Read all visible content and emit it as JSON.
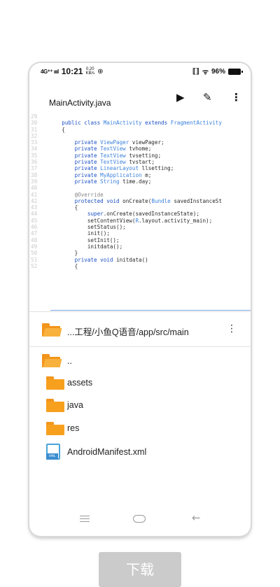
{
  "status_bar": {
    "signal": "4G⁺⁺ ıııl",
    "time": "10:21",
    "net_speed_value": "0.20",
    "net_speed_unit": "KB/s",
    "small_icon": "⊕",
    "vibrate": "⟦⟧",
    "wifi": "ᯤ",
    "battery_percent": "96%"
  },
  "toolbar": {
    "file_name": "MainActivity.java",
    "run_icon": "▶",
    "edit_icon": "✎",
    "more_icon": "⋮"
  },
  "code": {
    "lines": [
      {
        "n": "29",
        "parts": [
          {
            "t": "",
            "c": ""
          }
        ]
      },
      {
        "n": "30",
        "parts": [
          {
            "t": "    ",
            "c": ""
          },
          {
            "t": "public class ",
            "c": "kw"
          },
          {
            "t": "MainActivity ",
            "c": "ty"
          },
          {
            "t": "extends ",
            "c": "kw"
          },
          {
            "t": "FragmentActivity",
            "c": "ty"
          }
        ]
      },
      {
        "n": "31",
        "parts": [
          {
            "t": "    {",
            "c": ""
          }
        ]
      },
      {
        "n": "32",
        "parts": [
          {
            "t": "",
            "c": ""
          }
        ]
      },
      {
        "n": "33",
        "parts": [
          {
            "t": "        ",
            "c": ""
          },
          {
            "t": "private ",
            "c": "kw"
          },
          {
            "t": "ViewPager ",
            "c": "ty"
          },
          {
            "t": "viewPager;",
            "c": ""
          }
        ]
      },
      {
        "n": "34",
        "parts": [
          {
            "t": "        ",
            "c": ""
          },
          {
            "t": "private ",
            "c": "kw"
          },
          {
            "t": "TextView ",
            "c": "ty"
          },
          {
            "t": "tvhome;",
            "c": ""
          }
        ]
      },
      {
        "n": "35",
        "parts": [
          {
            "t": "        ",
            "c": ""
          },
          {
            "t": "private ",
            "c": "kw"
          },
          {
            "t": "TextView ",
            "c": "ty"
          },
          {
            "t": "tvsetting;",
            "c": ""
          }
        ]
      },
      {
        "n": "36",
        "parts": [
          {
            "t": "        ",
            "c": ""
          },
          {
            "t": "private ",
            "c": "kw"
          },
          {
            "t": "TextView ",
            "c": "ty"
          },
          {
            "t": "tvstart;",
            "c": ""
          }
        ]
      },
      {
        "n": "37",
        "parts": [
          {
            "t": "        ",
            "c": ""
          },
          {
            "t": "private ",
            "c": "kw"
          },
          {
            "t": "LinearLayout ",
            "c": "ty"
          },
          {
            "t": "llsetting;",
            "c": ""
          }
        ]
      },
      {
        "n": "38",
        "parts": [
          {
            "t": "        ",
            "c": ""
          },
          {
            "t": "private ",
            "c": "kw"
          },
          {
            "t": "MyApplication ",
            "c": "ty"
          },
          {
            "t": "m;",
            "c": ""
          }
        ]
      },
      {
        "n": "39",
        "parts": [
          {
            "t": "        ",
            "c": ""
          },
          {
            "t": "private ",
            "c": "kw"
          },
          {
            "t": "String ",
            "c": "ty"
          },
          {
            "t": "time.day;",
            "c": ""
          }
        ]
      },
      {
        "n": "40",
        "parts": [
          {
            "t": "",
            "c": ""
          }
        ]
      },
      {
        "n": "41",
        "parts": [
          {
            "t": "        ",
            "c": ""
          },
          {
            "t": "@Override",
            "c": "an"
          }
        ]
      },
      {
        "n": "42",
        "parts": [
          {
            "t": "        ",
            "c": ""
          },
          {
            "t": "protected void ",
            "c": "kw"
          },
          {
            "t": "onCreate(",
            "c": ""
          },
          {
            "t": "Bundle ",
            "c": "ty"
          },
          {
            "t": "savedInstanceSt",
            "c": ""
          }
        ]
      },
      {
        "n": "43",
        "parts": [
          {
            "t": "        {",
            "c": ""
          }
        ]
      },
      {
        "n": "44",
        "parts": [
          {
            "t": "            ",
            "c": ""
          },
          {
            "t": "super",
            "c": "kw"
          },
          {
            "t": ".onCreate(savedInstanceState);",
            "c": ""
          }
        ]
      },
      {
        "n": "45",
        "parts": [
          {
            "t": "            setContentView(",
            "c": ""
          },
          {
            "t": "R",
            "c": "ty"
          },
          {
            "t": ".layout.activity_main);",
            "c": ""
          }
        ]
      },
      {
        "n": "46",
        "parts": [
          {
            "t": "            setStatus();",
            "c": ""
          }
        ]
      },
      {
        "n": "47",
        "parts": [
          {
            "t": "            init();",
            "c": ""
          }
        ]
      },
      {
        "n": "48",
        "parts": [
          {
            "t": "            setInit();",
            "c": ""
          }
        ]
      },
      {
        "n": "49",
        "parts": [
          {
            "t": "            initdata();",
            "c": ""
          }
        ]
      },
      {
        "n": "50",
        "parts": [
          {
            "t": "        }",
            "c": ""
          }
        ]
      },
      {
        "n": "51",
        "parts": [
          {
            "t": "        ",
            "c": ""
          },
          {
            "t": "private void ",
            "c": "kw"
          },
          {
            "t": "initdata()",
            "c": ""
          }
        ]
      },
      {
        "n": "52",
        "parts": [
          {
            "t": "        {",
            "c": ""
          }
        ]
      }
    ]
  },
  "path_bar": {
    "path": "...工程/小鱼Q语音/app/src/main",
    "more_icon": "⋮"
  },
  "file_list": [
    {
      "name": "..",
      "icon": "folder-open-icon"
    },
    {
      "name": "assets",
      "icon": "folder-icon"
    },
    {
      "name": "java",
      "icon": "folder-icon"
    },
    {
      "name": "res",
      "icon": "folder-icon"
    },
    {
      "name": "AndroidManifest.xml",
      "icon": "xml-file-icon",
      "badge": "XML"
    }
  ],
  "nav_bar": {
    "back_icon": "←"
  },
  "download_button": {
    "label": "下载"
  },
  "colors": {
    "folder": "#f7a01e",
    "keyword": "#1a4fc4",
    "type": "#3c82dc",
    "xml_icon": "#3b8ed0",
    "download_button_bg": "#cbcbcb"
  }
}
